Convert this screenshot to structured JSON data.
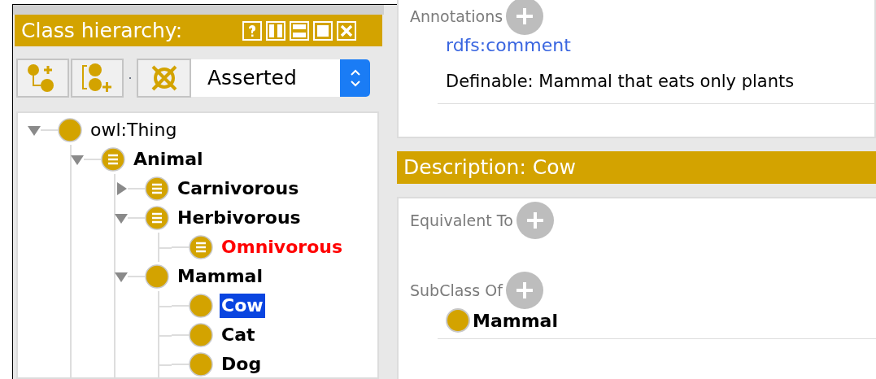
{
  "hierarchy": {
    "title": "Class hierarchy:",
    "mode": "Asserted",
    "tree": [
      {
        "label": "owl:Thing",
        "kind": "thing",
        "has_children": true,
        "expanded": true,
        "selected": false,
        "inconsistent": false,
        "children": [
          {
            "label": "Animal",
            "kind": "defined",
            "has_children": true,
            "expanded": true,
            "selected": false,
            "inconsistent": false,
            "children": [
              {
                "label": "Carnivorous",
                "kind": "defined",
                "has_children": true,
                "expanded": false,
                "selected": false,
                "inconsistent": false
              },
              {
                "label": "Herbivorous",
                "kind": "defined",
                "has_children": true,
                "expanded": true,
                "selected": false,
                "inconsistent": false,
                "children": [
                  {
                    "label": "Omnivorous",
                    "kind": "defined",
                    "has_children": false,
                    "selected": false,
                    "inconsistent": true
                  }
                ]
              },
              {
                "label": "Mammal",
                "kind": "primitive",
                "has_children": true,
                "expanded": true,
                "selected": false,
                "inconsistent": false,
                "children": [
                  {
                    "label": "Cow",
                    "kind": "primitive",
                    "has_children": false,
                    "selected": true,
                    "inconsistent": false
                  },
                  {
                    "label": "Cat",
                    "kind": "primitive",
                    "has_children": false,
                    "selected": false,
                    "inconsistent": false
                  },
                  {
                    "label": "Dog",
                    "kind": "primitive",
                    "has_children": false,
                    "selected": false,
                    "inconsistent": false
                  }
                ]
              }
            ]
          }
        ]
      }
    ]
  },
  "annotations": {
    "label": "Annotations",
    "items": [
      {
        "property": "rdfs:comment",
        "value": "Definable: Mammal that eats only plants"
      }
    ]
  },
  "description": {
    "title": "Description: Cow",
    "sections": [
      {
        "label": "Equivalent To"
      },
      {
        "label": "SubClass Of",
        "items": [
          "Mammal"
        ]
      }
    ]
  }
}
